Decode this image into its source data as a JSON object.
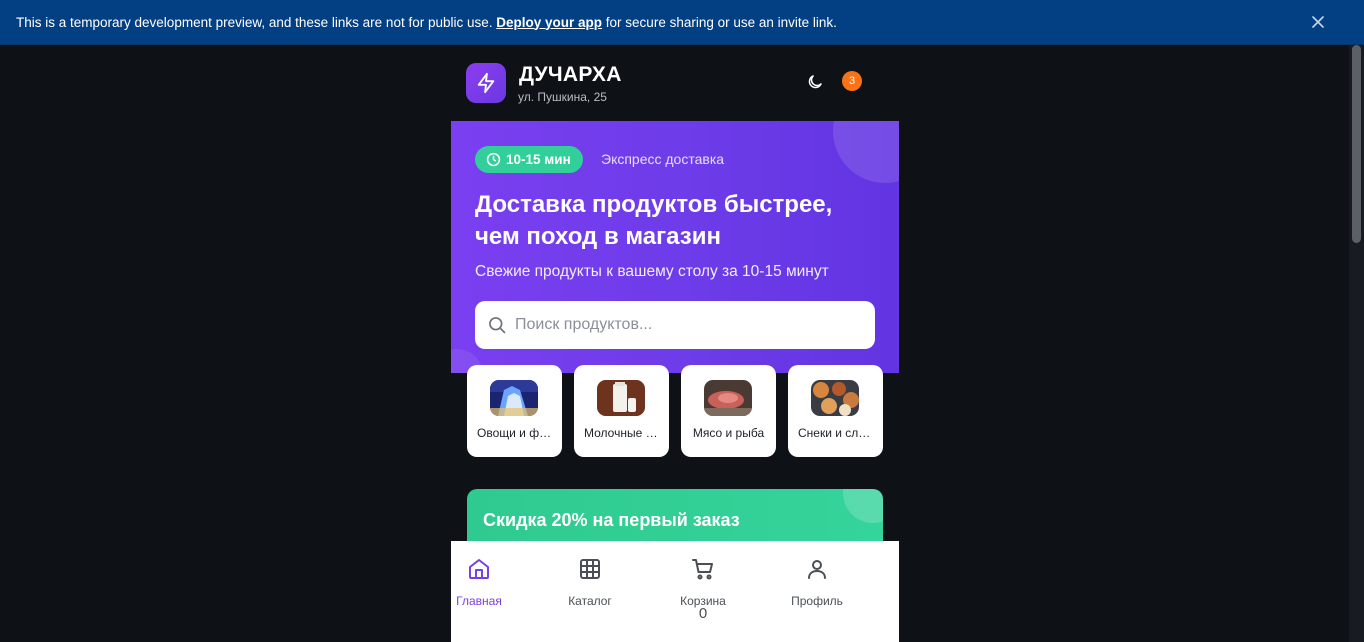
{
  "dev_banner": {
    "text_before": "This is a temporary development preview, and these links are not for public use.",
    "link_text": "Deploy your app",
    "text_after": "for secure sharing or use an invite link."
  },
  "header": {
    "brand": "ДУЧАРХА",
    "address": "ул. Пушкина, 25",
    "notification_count": "3"
  },
  "hero": {
    "time_pill": "10-15 мин",
    "delivery_note": "Экспресс доставка",
    "title": "Доставка продуктов быстрее, чем поход в магазин",
    "subtitle": "Свежие продукты к вашему столу за 10-15 минут",
    "search_placeholder": "Поиск продуктов..."
  },
  "categories": [
    {
      "label": "Овощи и фрукты",
      "icon": "city-photo"
    },
    {
      "label": "Молочные продукты",
      "icon": "milk-photo"
    },
    {
      "label": "Мясо и рыба",
      "icon": "meat-photo"
    },
    {
      "label": "Снеки и сладости",
      "icon": "snacks-photo"
    }
  ],
  "promo": {
    "title": "Скидка 20% на первый заказ"
  },
  "bottom_nav": {
    "items": [
      {
        "label": "Главная",
        "icon": "home-icon"
      },
      {
        "label": "Каталог",
        "icon": "grid-icon"
      },
      {
        "label": "Корзина",
        "icon": "cart-icon"
      },
      {
        "label": "Профиль",
        "icon": "user-icon"
      }
    ],
    "cart_count": "0"
  },
  "colors": {
    "banner_bg": "#033f83",
    "page_bg": "#0e1217",
    "accent_purple": "#7b3fe4",
    "accent_green": "#32cf9b",
    "badge_orange": "#f97316"
  }
}
